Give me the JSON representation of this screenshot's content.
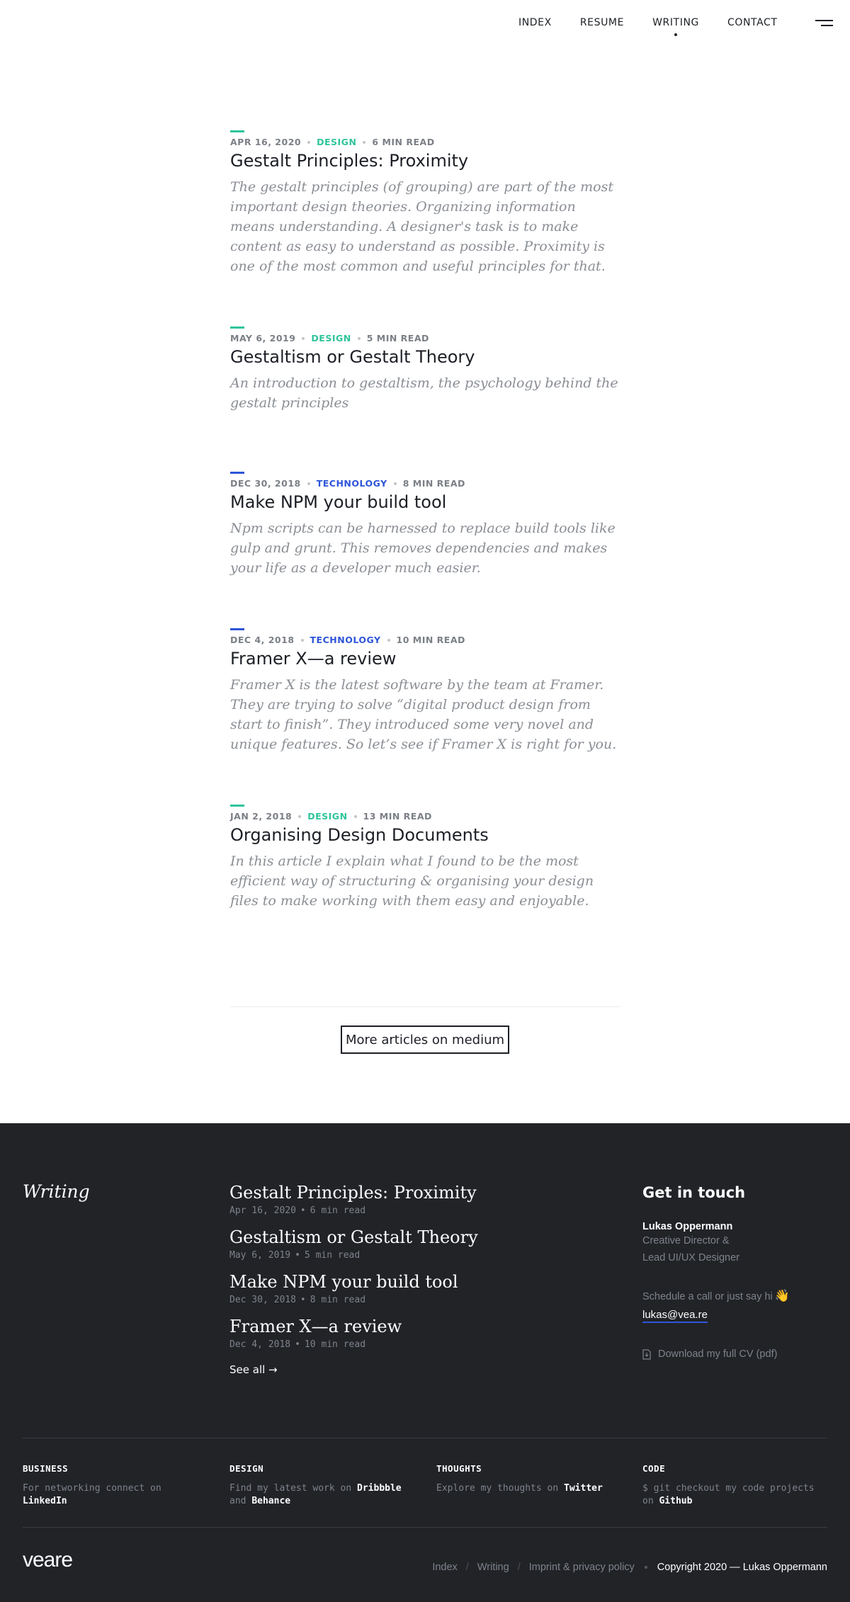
{
  "nav": {
    "items": [
      "INDEX",
      "RESUME",
      "WRITING",
      "CONTACT"
    ],
    "active": "WRITING"
  },
  "colors": {
    "design": "#2ec49b",
    "technology": "#2d55d8",
    "text": "#1c1f25",
    "muted": "#8a8e94",
    "footer_bg": "#212327"
  },
  "articles": [
    {
      "date": "APR 16, 2020",
      "category": "DESIGN",
      "read": "6 MIN READ",
      "title": "Gestalt Principles: Proximity",
      "excerpt": "The gestalt principles (of grouping) are part of the most important design theories. Organizing information means understanding. A designer's task is to make content as easy to understand as possible. Proximity is one of the most common and useful principles for that."
    },
    {
      "date": "MAY 6, 2019",
      "category": "DESIGN",
      "read": "5 MIN READ",
      "title": "Gestaltism or Gestalt Theory",
      "excerpt": "An introduction to gestaltism, the psychology behind the gestalt principles"
    },
    {
      "date": "DEC 30, 2018",
      "category": "TECHNOLOGY",
      "read": "8 MIN READ",
      "title": "Make NPM your build tool",
      "excerpt": "Npm scripts can be harnessed to replace build tools like gulp and grunt. This removes dependencies and makes your life as a developer much easier."
    },
    {
      "date": "DEC 4, 2018",
      "category": "TECHNOLOGY",
      "read": "10 MIN READ",
      "title": "Framer X—a review",
      "excerpt": "Framer X is the latest software by the team at Framer. They are trying to solve “digital product design from start to finish”. They introduced some very novel and unique features. So let’s see if Framer X is right for you."
    },
    {
      "date": "JAN 2, 2018",
      "category": "DESIGN",
      "read": "13 MIN READ",
      "title": "Organising Design Documents",
      "excerpt": "In this article I explain what I found to be the most efficient way of structuring & organising your design files to make working with them easy and enjoyable."
    }
  ],
  "more_button": "More articles on medium",
  "footer": {
    "heading": "Writing",
    "posts": [
      {
        "title": "Gestalt Principles: Proximity",
        "date": "Apr 16, 2020",
        "read": "6 min read"
      },
      {
        "title": "Gestaltism or Gestalt Theory",
        "date": "May 6, 2019",
        "read": "5 min read"
      },
      {
        "title": "Make NPM your build tool",
        "date": "Dec 30, 2018",
        "read": "8 min read"
      },
      {
        "title": "Framer X—a review",
        "date": "Dec 4, 2018",
        "read": "10 min read"
      }
    ],
    "meta_separator": "•",
    "see_all": "See all →",
    "contact": {
      "heading": "Get in touch",
      "name": "Lukas Oppermann",
      "role_line1": "Creative Director &",
      "role_line2": "Lead UI/UX Designer",
      "schedule": "Schedule a call or just say hi",
      "wave": "👋",
      "email": "lukas@vea.re",
      "cv": "Download my full CV (pdf)"
    },
    "columns": [
      {
        "heading": "BUSINESS",
        "pre": "For networking connect on ",
        "link1": "LinkedIn",
        "mid": "",
        "link2": ""
      },
      {
        "heading": "DESIGN",
        "pre": "Find my latest work on ",
        "link1": "Dribbble",
        "mid": " and ",
        "link2": "Behance"
      },
      {
        "heading": "THOUGHTS",
        "pre": "Explore my thoughts on ",
        "link1": "Twitter",
        "mid": "",
        "link2": ""
      },
      {
        "heading": "CODE",
        "pre": "$ git checkout my code projects on ",
        "link1": "Github",
        "mid": "",
        "link2": ""
      }
    ],
    "logo": "veare",
    "links": [
      "Index",
      "Writing",
      "Imprint & privacy policy"
    ],
    "link_separator": "/",
    "copyright": "Copyright 2020 — Lukas Oppermann"
  }
}
